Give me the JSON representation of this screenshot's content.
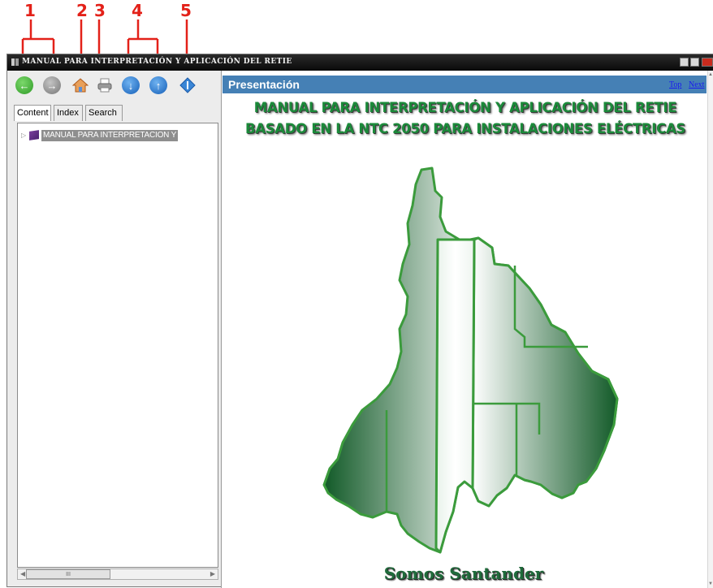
{
  "callouts": [
    "1",
    "2",
    "3",
    "4",
    "5"
  ],
  "window": {
    "title": "MANUAL PARA INTERPRETACIÓN Y APLICACIÓN DEL RETIE"
  },
  "toolbar": {
    "buttons": [
      {
        "name": "back",
        "icon": "arrow-left-icon",
        "color": "#38a82f"
      },
      {
        "name": "forward",
        "icon": "arrow-right-icon",
        "color": "#8c8c8c"
      },
      {
        "name": "home",
        "icon": "home-icon",
        "color": "#e07b25"
      },
      {
        "name": "print",
        "icon": "printer-icon",
        "color": "#6c6c6c"
      },
      {
        "name": "next-topic",
        "icon": "arrow-down-icon",
        "color": "#1e6fc8"
      },
      {
        "name": "previous-topic",
        "icon": "arrow-up-icon",
        "color": "#1e6fc8"
      },
      {
        "name": "sync-toc",
        "icon": "locate-icon",
        "color": "#2e7bd0"
      }
    ]
  },
  "tabs": {
    "content": "Content",
    "index": "Index",
    "search": "Search"
  },
  "tree": {
    "items": [
      {
        "label": "MANUAL PARA INTERPRETACION Y"
      }
    ]
  },
  "scrollbar": {
    "thumb": "III"
  },
  "content": {
    "header_title": "Presentación",
    "link_top": "Top",
    "link_next": "Next",
    "title_line1": "MANUAL PARA INTERPRETACIÓN Y APLICACIÓN DEL RETIE",
    "title_line2": "BASADO EN LA NTC 2050 PARA INSTALACIONES ELÉCTRICAS",
    "footer": "Somos Santander"
  },
  "colors": {
    "accent": "#4580b5",
    "callout": "#e32119",
    "title_green": "#1b8a3a",
    "map_green": "#3b9b3c"
  }
}
